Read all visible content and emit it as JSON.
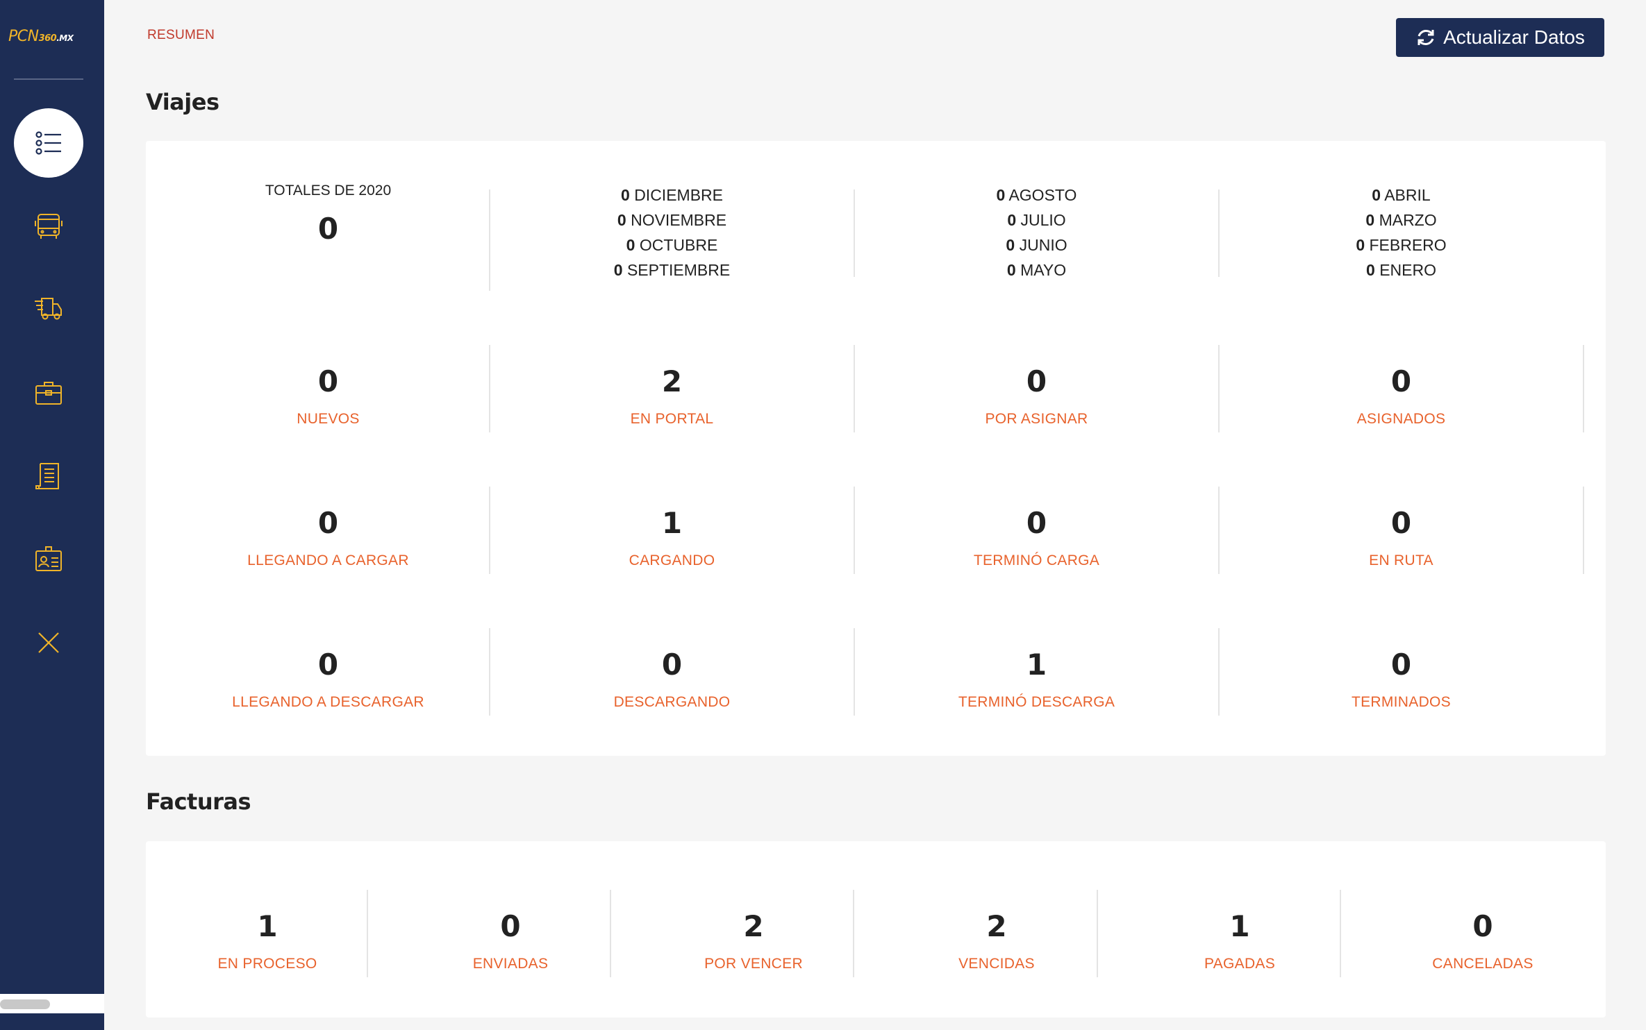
{
  "sidebar": {
    "logo": {
      "main": "PCN",
      "sub": "360",
      "suffix": ".MX"
    },
    "items": [
      {
        "icon": "list-icon",
        "active": true
      },
      {
        "icon": "bus-icon",
        "active": false
      },
      {
        "icon": "delivery-truck-icon",
        "active": false
      },
      {
        "icon": "briefcase-icon",
        "active": false
      },
      {
        "icon": "document-icon",
        "active": false
      },
      {
        "icon": "id-badge-icon",
        "active": false
      },
      {
        "icon": "close-icon",
        "active": false
      }
    ],
    "accent_color": "#f0b429",
    "background_color": "#1d2d55"
  },
  "header": {
    "breadcrumb": "RESUMEN",
    "refresh_label": "Actualizar Datos"
  },
  "viajes": {
    "title": "Viajes",
    "totals": {
      "label": "TOTALES DE 2020",
      "value": "0"
    },
    "months": [
      [
        {
          "n": "0",
          "m": "DICIEMBRE"
        },
        {
          "n": "0",
          "m": "NOVIEMBRE"
        },
        {
          "n": "0",
          "m": "OCTUBRE"
        },
        {
          "n": "0",
          "m": "SEPTIEMBRE"
        }
      ],
      [
        {
          "n": "0",
          "m": "AGOSTO"
        },
        {
          "n": "0",
          "m": "JULIO"
        },
        {
          "n": "0",
          "m": "JUNIO"
        },
        {
          "n": "0",
          "m": "MAYO"
        }
      ],
      [
        {
          "n": "0",
          "m": "ABRIL"
        },
        {
          "n": "0",
          "m": "MARZO"
        },
        {
          "n": "0",
          "m": "FEBRERO"
        },
        {
          "n": "0",
          "m": "ENERO"
        }
      ]
    ],
    "stats": [
      [
        {
          "value": "0",
          "label": "NUEVOS"
        },
        {
          "value": "2",
          "label": "EN PORTAL"
        },
        {
          "value": "0",
          "label": "POR ASIGNAR"
        },
        {
          "value": "0",
          "label": "ASIGNADOS"
        }
      ],
      [
        {
          "value": "0",
          "label": "LLEGANDO A CARGAR"
        },
        {
          "value": "1",
          "label": "CARGANDO"
        },
        {
          "value": "0",
          "label": "TERMINÓ CARGA"
        },
        {
          "value": "0",
          "label": "EN RUTA"
        }
      ],
      [
        {
          "value": "0",
          "label": "LLEGANDO A DESCARGAR"
        },
        {
          "value": "0",
          "label": "DESCARGANDO"
        },
        {
          "value": "1",
          "label": "TERMINÓ DESCARGA"
        },
        {
          "value": "0",
          "label": "TERMINADOS"
        }
      ]
    ]
  },
  "facturas": {
    "title": "Facturas",
    "stats": [
      {
        "value": "1",
        "label": "EN PROCESO"
      },
      {
        "value": "0",
        "label": "ENVIADAS"
      },
      {
        "value": "2",
        "label": "POR VENCER"
      },
      {
        "value": "2",
        "label": "VENCIDAS"
      },
      {
        "value": "1",
        "label": "PAGADAS"
      },
      {
        "value": "0",
        "label": "CANCELADAS"
      }
    ]
  },
  "colors": {
    "label_orange": "#e8622c",
    "breadcrumb_red": "#c0392b"
  }
}
